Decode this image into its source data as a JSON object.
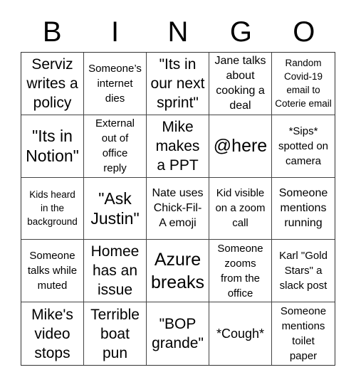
{
  "title_letters": [
    "B",
    "I",
    "N",
    "G",
    "O"
  ],
  "cells": [
    {
      "text": "Serviz\nwrites a\npolicy",
      "size": "s20"
    },
    {
      "text": "Someone’s\ninternet\ndies",
      "size": "s15"
    },
    {
      "text": "\"Its in\nour next\nsprint\"",
      "size": "s20"
    },
    {
      "text": "Jane talks\nabout\ncooking a\ndeal",
      "size": "s16"
    },
    {
      "text": "Random\nCovid-19\nemail to\nCoterie email",
      "size": "s13"
    },
    {
      "text": "\"Its in\nNotion\"",
      "size": "s22"
    },
    {
      "text": "External\nout of\noffice\nreply",
      "size": "s15"
    },
    {
      "text": "Mike\nmakes\na PPT",
      "size": "s20"
    },
    {
      "text": "@here",
      "size": "s24"
    },
    {
      "text": "*Sips*\nspotted on\ncamera",
      "size": "s15"
    },
    {
      "text": "Kids heard\nin the\nbackground",
      "size": "s13"
    },
    {
      "text": "\"Ask\nJustin\"",
      "size": "s22"
    },
    {
      "text": "Nate uses\nChick-Fil-\nA emoji",
      "size": "s16"
    },
    {
      "text": "Kid visible\non a zoom\ncall",
      "size": "s15"
    },
    {
      "text": "Someone\nmentions\nrunning",
      "size": "s16"
    },
    {
      "text": "Someone\ntalks while\nmuted",
      "size": "s15"
    },
    {
      "text": "Homee\nhas an\nissue",
      "size": "s20"
    },
    {
      "text": "Azure\nbreaks",
      "size": "s24"
    },
    {
      "text": "Someone\nzooms\nfrom the\noffice",
      "size": "s15"
    },
    {
      "text": "Karl \"Gold\nStars\" a\nslack post",
      "size": "s15"
    },
    {
      "text": "Mike's\nvideo\nstops",
      "size": "s20"
    },
    {
      "text": "Terrible\nboat\npun",
      "size": "s20"
    },
    {
      "text": "\"BOP\ngrande\"",
      "size": "s20"
    },
    {
      "text": "*Cough*",
      "size": "s18"
    },
    {
      "text": "Someone\nmentions\ntoilet\npaper",
      "size": "s15"
    }
  ]
}
